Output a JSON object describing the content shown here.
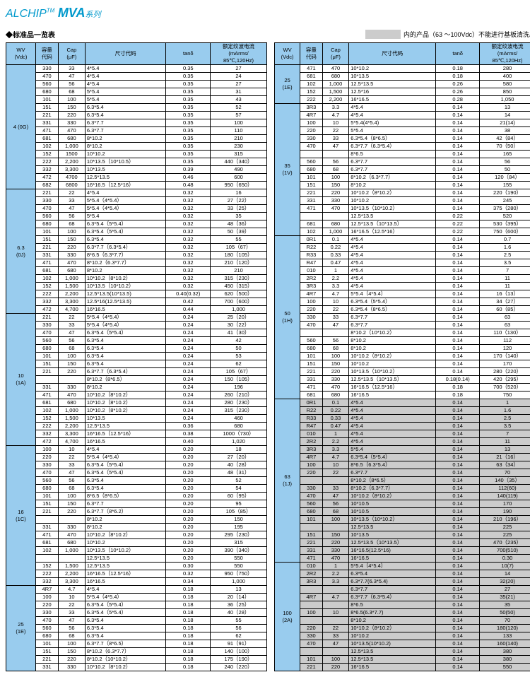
{
  "title": {
    "brand": "ALCHIP",
    "tm": "TM",
    "mva": "MVA",
    "series": "系列"
  },
  "subtitle": "◆标准品一览表",
  "note": "内的产品（63 ～100Vdc）不能进行基板清洗。",
  "headers": {
    "wv": "WV\n(Vdc)",
    "cap_code": "容量\n代码",
    "cap": "Cap\n(μF)",
    "size": "尺寸代码",
    "tan": "tanδ",
    "ripple": "额定纹波电流\n(mArms/\n85℃,120Hz)"
  },
  "left": [
    {
      "wv": "4 (0G)",
      "rows": [
        [
          "330",
          "33",
          "4*5.4",
          "0.35",
          "27"
        ],
        [
          "470",
          "47",
          "4*5.4",
          "0.35",
          "24"
        ],
        [
          "560",
          "56",
          "4*5.4",
          "0.35",
          "27"
        ],
        [
          "680",
          "68",
          "5*5.4",
          "0.35",
          "31"
        ],
        [
          "101",
          "100",
          "5*5.4",
          "0.35",
          "43"
        ],
        [
          "151",
          "150",
          "6.3*5.4",
          "0.35",
          "52"
        ],
        [
          "221",
          "220",
          "6.3*5.4",
          "0.35",
          "57"
        ],
        [
          "331",
          "330",
          "6.3*7.7",
          "0.35",
          "100"
        ],
        [
          "471",
          "470",
          "6.3*7.7",
          "0.35",
          "110"
        ],
        [
          "681",
          "680",
          "8*10.2",
          "0.35",
          "210"
        ],
        [
          "102",
          "1,000",
          "8*10.2",
          "0.35",
          "230"
        ],
        [
          "152",
          "1500",
          "10*10.2",
          "0.35",
          "315"
        ],
        [
          "222",
          "2,200",
          "10*13.5（10*10.5）",
          "0.35",
          "440（340）"
        ],
        [
          "332",
          "3,300",
          "10*13.5",
          "0.39",
          "490"
        ],
        [
          "472",
          "4700",
          "12.5*13.5",
          "0.46",
          "600"
        ],
        [
          "682",
          "6800",
          "16*16.5（12.5*16）",
          "0.48",
          "950（650）"
        ]
      ]
    },
    {
      "wv": "6.3\n(0J)",
      "rows": [
        [
          "221",
          "22",
          "4*5.4",
          "0.32",
          "16"
        ],
        [
          "330",
          "33",
          "5*5.4（4*5.4）",
          "0.32",
          "27（22）"
        ],
        [
          "470",
          "47",
          "5*5.4（4*5.4）",
          "0.32",
          "33（25）"
        ],
        [
          "560",
          "56",
          "5*5.4",
          "0.32",
          "35"
        ],
        [
          "680",
          "68",
          "6.3*5.4（5*5.4）",
          "0.32",
          "48（36）"
        ],
        [
          "101",
          "100",
          "6.3*5.4（5*5.4）",
          "0.32",
          "50（39）"
        ],
        [
          "151",
          "150",
          "6.3*5.4",
          "0.32",
          "55"
        ],
        [
          "221",
          "220",
          "6.3*7.7（6.3*5.4）",
          "0.32",
          "105（67）"
        ],
        [
          "331",
          "330",
          "8*6.5（6.3*7.7）",
          "0.32",
          "180（105）"
        ],
        [
          "471",
          "470",
          "8*10.2（6.3*7.7）",
          "0.32",
          "210（120）"
        ],
        [
          "681",
          "680",
          "8*10.2",
          "0.32",
          "210"
        ],
        [
          "102",
          "1,000",
          "10*10.2（8*10.2）",
          "0.32",
          "315（230）"
        ],
        [
          "152",
          "1,500",
          "10*13.5（10*10.2）",
          "0.32",
          "450（315）"
        ],
        [
          "222",
          "2,200",
          "12.5*13.5(10*13.5)",
          "0.40(0.32)",
          "620（500）"
        ],
        [
          "332",
          "3,300",
          "12.5*16(12.5*13.5)",
          "0.42",
          "700（600）"
        ],
        [
          "472",
          "4,700",
          "16*16.5",
          "0.44",
          "1,000"
        ]
      ]
    },
    {
      "wv": "10\n(1A)",
      "rows": [
        [
          "221",
          "22",
          "5*5.4（4*5.4）",
          "0.24",
          "25（20）"
        ],
        [
          "330",
          "33",
          "5*5.4（4*5.4）",
          "0.24",
          "30（22）"
        ],
        [
          "470",
          "47",
          "6.3*5.4（5*5.4）",
          "0.24",
          "41（30）"
        ],
        [
          "560",
          "56",
          "6.3*5.4",
          "0.24",
          "42"
        ],
        [
          "680",
          "68",
          "6.3*5.4",
          "0.24",
          "50"
        ],
        [
          "101",
          "100",
          "6.3*5.4",
          "0.24",
          "53"
        ],
        [
          "151",
          "150",
          "6.3*5.4",
          "0.24",
          "62"
        ],
        [
          "221",
          "220",
          "6.3*7.7（6.3*5.4）",
          "0.24",
          "105（67）"
        ],
        [
          "",
          "",
          "8*10.2（8*6.5）",
          "0.24",
          "150（105）"
        ],
        [
          "331",
          "330",
          "8*10.2",
          "0.24",
          "196"
        ],
        [
          "471",
          "470",
          "10*10.2（8*10.2）",
          "0.24",
          "260（210）"
        ],
        [
          "681",
          "680",
          "10*10.2（8*10.2）",
          "0.24",
          "280（230）"
        ],
        [
          "102",
          "1,000",
          "10*10.2（8*10.2）",
          "0.24",
          "315（230）"
        ],
        [
          "152",
          "1,500",
          "10*13.5",
          "0.24",
          "460"
        ],
        [
          "222",
          "2,200",
          "12.5*13.5",
          "0.36",
          "680"
        ],
        [
          "332",
          "3,300",
          "16*16.5（12.5*16）",
          "0.38",
          "1000（730）"
        ],
        [
          "472",
          "4,700",
          "16*16.5",
          "0.40",
          "1,020"
        ]
      ]
    },
    {
      "wv": "16\n(1C)",
      "rows": [
        [
          "100",
          "10",
          "4*5.4",
          "0.20",
          "18"
        ],
        [
          "220",
          "22",
          "5*5.4（4*5.4）",
          "0.20",
          "27（20）"
        ],
        [
          "330",
          "33",
          "6.3*5.4（5*5.4）",
          "0.20",
          "40（28）"
        ],
        [
          "470",
          "47",
          "6.3*5.4（5*5.4）",
          "0.20",
          "48（31）"
        ],
        [
          "560",
          "56",
          "6.3*5.4",
          "0.20",
          "52"
        ],
        [
          "680",
          "68",
          "6.3*5.4",
          "0.20",
          "54"
        ],
        [
          "101",
          "100",
          "8*6.5（8*6.5）",
          "0.20",
          "60（95）"
        ],
        [
          "151",
          "150",
          "6.3*7.7",
          "0.20",
          "95"
        ],
        [
          "221",
          "220",
          "6.3*7.7（8*6.2）",
          "0.20",
          "105（85）"
        ],
        [
          "",
          "",
          "8*10.2",
          "0.20",
          "150"
        ],
        [
          "331",
          "330",
          "8*10.2",
          "0.20",
          "195"
        ],
        [
          "471",
          "470",
          "10*10.2（8*10.2）",
          "0.20",
          "295（230）"
        ],
        [
          "681",
          "680",
          "10*10.2",
          "0.20",
          "315"
        ],
        [
          "102",
          "1,000",
          "10*13.5（10*10.2）",
          "0.20",
          "390（340）"
        ],
        [
          "",
          "",
          "12.5*13.5",
          "0.20",
          "550"
        ],
        [
          "152",
          "1,500",
          "12.5*13.5",
          "0.30",
          "550"
        ],
        [
          "222",
          "2,200",
          "16*16.5（12.5*16）",
          "0.32",
          "950（750）"
        ],
        [
          "332",
          "3,300",
          "16*16.5",
          "0.34",
          "1,000"
        ]
      ]
    },
    {
      "wv": "25\n(1E)",
      "rows": [
        [
          "4R7",
          "4.7",
          "4*5.4",
          "0.18",
          "13"
        ],
        [
          "100",
          "10",
          "5*5.4（4*5.4）",
          "0.18",
          "20（14）"
        ],
        [
          "220",
          "22",
          "6.3*5.4（5*5.4）",
          "0.18",
          "36（25）"
        ],
        [
          "330",
          "33",
          "6.3*5.4（5*5.4）",
          "0.18",
          "40（28）"
        ],
        [
          "470",
          "47",
          "6.3*5.4",
          "0.18",
          "55"
        ],
        [
          "560",
          "56",
          "6.3*5.4",
          "0.18",
          "56"
        ],
        [
          "680",
          "68",
          "6.3*5.4",
          "0.18",
          "62"
        ],
        [
          "101",
          "100",
          "6.3*7.7（8*6.5）",
          "0.18",
          "91（91）"
        ],
        [
          "151",
          "150",
          "8*10.2（6.3*7.7）",
          "0.18",
          "140（100）"
        ],
        [
          "221",
          "220",
          "8*10.2（10*10.2）",
          "0.18",
          "175（190）"
        ],
        [
          "331",
          "330",
          "10*10.2（8*10.2）",
          "0.18",
          "240（220）"
        ]
      ]
    }
  ],
  "right": [
    {
      "wv": "25\n(1E)",
      "rows": [
        [
          "471",
          "470",
          "10*10.2",
          "0.18",
          "280"
        ],
        [
          "681",
          "680",
          "10*13.5",
          "0.18",
          "400"
        ],
        [
          "102",
          "1,000",
          "12.5*13.5",
          "0.26",
          "580"
        ],
        [
          "152",
          "1,500",
          "12.5*16",
          "0.26",
          "850"
        ],
        [
          "222",
          "2,200",
          "16*16.5",
          "0.28",
          "1,050"
        ]
      ]
    },
    {
      "wv": "35\n(1V)",
      "rows": [
        [
          "3R3",
          "3.3",
          "4*5.4",
          "0.14",
          "13"
        ],
        [
          "4R7",
          "4.7",
          "4*5.4",
          "0.14",
          "14"
        ],
        [
          "100",
          "10",
          "5*5.4(4*5.4)",
          "0.14",
          "21(14)"
        ],
        [
          "220",
          "22",
          "5*5.4",
          "0.14",
          "38"
        ],
        [
          "330",
          "33",
          "6.3*5.4（8*6.5）",
          "0.14",
          "42（84）"
        ],
        [
          "470",
          "47",
          "6.3*7.7（6.3*5.4）",
          "0.14",
          "70（50）"
        ],
        [
          "",
          "",
          "8*6.5",
          "0.14",
          "165"
        ],
        [
          "560",
          "56",
          "6.3*7.7",
          "0.14",
          "56"
        ],
        [
          "680",
          "68",
          "6.3*7.7",
          "0.14",
          "50"
        ],
        [
          "101",
          "100",
          "8*10.2（6.3*7.7）",
          "0.14",
          "120（84）"
        ],
        [
          "151",
          "150",
          "8*10.2",
          "0.14",
          "155"
        ],
        [
          "221",
          "220",
          "10*10.2（8*10.2）",
          "0.14",
          "220（190）"
        ],
        [
          "331",
          "330",
          "10*10.2",
          "0.14",
          "245"
        ],
        [
          "471",
          "470",
          "10*13.5（10*10.2）",
          "0.14",
          "375（280）"
        ],
        [
          "",
          "",
          "12.5*13.5",
          "0.22",
          "520"
        ],
        [
          "681",
          "680",
          "12.5*13.5（10*13.5）",
          "0.22",
          "530（395）"
        ],
        [
          "102",
          "1,000",
          "16*16.5（12.5*16）",
          "0.22",
          "750（600）"
        ]
      ]
    },
    {
      "wv": "50\n(1H)",
      "rows": [
        [
          "0R1",
          "0.1",
          "4*5.4",
          "0.14",
          "0.7"
        ],
        [
          "R22",
          "0.22",
          "4*5.4",
          "0.14",
          "1.6"
        ],
        [
          "R33",
          "0.33",
          "4*5.4",
          "0.14",
          "2.5"
        ],
        [
          "R47",
          "0.47",
          "4*5.4",
          "0.14",
          "3.5"
        ],
        [
          "010",
          "1",
          "4*5.4",
          "0.14",
          "7"
        ],
        [
          "2R2",
          "2.2",
          "4*5.4",
          "0.14",
          "11"
        ],
        [
          "3R3",
          "3.3",
          "4*5.4",
          "0.14",
          "11"
        ],
        [
          "4R7",
          "4.7",
          "5*5.4（4*5.4）",
          "0.14",
          "16（13）"
        ],
        [
          "100",
          "10",
          "6.3*5.4（5*5.4）",
          "0.14",
          "34（27）"
        ],
        [
          "220",
          "22",
          "6.3*5.4（8*6.5）",
          "0.14",
          "60（85）"
        ],
        [
          "330",
          "33",
          "6.3*7.7",
          "0.14",
          "63"
        ],
        [
          "470",
          "47",
          "6.3*7.7",
          "0.14",
          "63"
        ],
        [
          "",
          "",
          "8*10.2（10*10.2）",
          "0.14",
          "110（130）"
        ],
        [
          "560",
          "56",
          "8*10.2",
          "0.14",
          "112"
        ],
        [
          "680",
          "68",
          "8*10.2",
          "0.14",
          "120"
        ],
        [
          "101",
          "100",
          "10*10.2（8*10.2）",
          "0.14",
          "170（140）"
        ],
        [
          "151",
          "150",
          "10*10.2",
          "0.14",
          "170"
        ],
        [
          "221",
          "220",
          "10*13.5（10*10.2）",
          "0.14",
          "280（220）"
        ],
        [
          "331",
          "330",
          "12.5*13.5（10*13.5）",
          "0.18(0.14)",
          "420（295）"
        ],
        [
          "471",
          "470",
          "16*16.5（12.5*16）",
          "0.18",
          "700（520）"
        ],
        [
          "681",
          "680",
          "16*16.5",
          "0.18",
          "750"
        ]
      ]
    },
    {
      "wv": "63\n(1J)",
      "gray": true,
      "rows": [
        [
          "0R1",
          "0.1",
          "4*5.4",
          "0.14",
          "1"
        ],
        [
          "R22",
          "0.22",
          "4*5.4",
          "0.14",
          "1.6"
        ],
        [
          "R33",
          "0.33",
          "4*5.4",
          "0.14",
          "2.5"
        ],
        [
          "R47",
          "0.47",
          "4*5.4",
          "0.14",
          "3.5"
        ],
        [
          "010",
          "1",
          "4*5.4",
          "0.14",
          "7"
        ],
        [
          "2R2",
          "2.2",
          "4*5.4",
          "0.14",
          "11"
        ],
        [
          "3R3",
          "3.3",
          "5*5.4",
          "0.14",
          "13"
        ],
        [
          "4R7",
          "4.7",
          "6.3*5.4（5*5.4）",
          "0.14",
          "21（16）"
        ],
        [
          "100",
          "10",
          "8*6.5（6.3*5.4）",
          "0.14",
          "63（34）"
        ],
        [
          "220",
          "22",
          "6.3*7.7",
          "0.14",
          "70"
        ],
        [
          "",
          "",
          "8*10.2（8*6.5）",
          "0.14",
          "140（35）"
        ],
        [
          "330",
          "33",
          "8*10.2（6.3*7.7）",
          "0.14",
          "112(60)"
        ],
        [
          "470",
          "47",
          "10*10.2（8*10.2）",
          "0.14",
          "140(119)"
        ],
        [
          "560",
          "56",
          "10*10.5",
          "0.14",
          "170"
        ],
        [
          "680",
          "68",
          "10*10.5",
          "0.14",
          "190"
        ],
        [
          "101",
          "100",
          "10*13.5（10*10.2）",
          "0.14",
          "210（196）"
        ],
        [
          "",
          "",
          "12.5*13.5",
          "0.14",
          "225"
        ],
        [
          "151",
          "150",
          "10*13.5",
          "0.14",
          "225"
        ],
        [
          "221",
          "220",
          "12.5*13.5（10*13.5）",
          "0.14",
          "470（235）"
        ],
        [
          "331",
          "330",
          "16*16.5(12.5*16)",
          "0.14",
          "700(510)"
        ],
        [
          "471",
          "470",
          "16*16.5",
          "0.14",
          "0.30"
        ]
      ]
    },
    {
      "wv": "100\n(2A)",
      "gray": true,
      "rows": [
        [
          "010",
          "1",
          "5*5.4（4*5.4）",
          "0.14",
          "10(7)"
        ],
        [
          "2R2",
          "2.2",
          "6.3*5.4",
          "0.14",
          "14"
        ],
        [
          "3R3",
          "3.3",
          "6.3*7.7(6.3*5.4)",
          "0.14",
          "32(20)"
        ],
        [
          "",
          "",
          "6.3*7.7",
          "0.14",
          "27"
        ],
        [
          "4R7",
          "4.7",
          "6.3*7.7（6.3*5.4）",
          "0.14",
          "35(21)"
        ],
        [
          "",
          "",
          "8*6.5",
          "0.14",
          "35"
        ],
        [
          "100",
          "10",
          "8*6.5(6.3*7.7)",
          "0.14",
          "50(50)"
        ],
        [
          "",
          "",
          "8*10.2",
          "0.14",
          "70"
        ],
        [
          "220",
          "22",
          "10*10.2（8*10.2）",
          "0.14",
          "180(120)"
        ],
        [
          "330",
          "33",
          "10*10.2",
          "0.14",
          "133"
        ],
        [
          "470",
          "47",
          "10*13.5(10*10.2)",
          "0.14",
          "160(140)"
        ],
        [
          "",
          "",
          "12.5*13.5",
          "0.14",
          "380"
        ],
        [
          "101",
          "100",
          "12.5*13.5",
          "0.14",
          "380"
        ],
        [
          "221",
          "220",
          "16*16.5",
          "0.14",
          "550"
        ]
      ]
    }
  ]
}
